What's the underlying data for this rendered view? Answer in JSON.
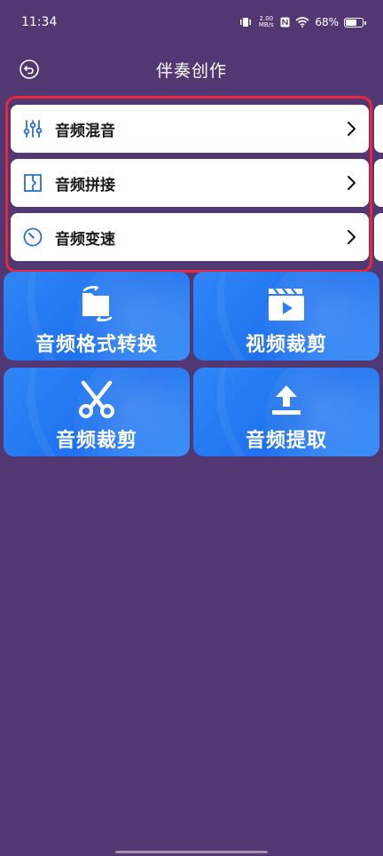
{
  "status_bar": {
    "time": "11:34",
    "net_speed_value": "2.00",
    "net_speed_unit": "MB/s",
    "battery": "68%"
  },
  "header": {
    "title": "伴奏创作"
  },
  "rows": [
    {
      "label": "音频混音",
      "icon": "sliders-icon"
    },
    {
      "label": "音频拼接",
      "icon": "splice-icon"
    },
    {
      "label": "音频变速",
      "icon": "speed-dial-icon"
    }
  ],
  "tiles": [
    {
      "label": "音频格式转换",
      "icon": "folder-convert-icon"
    },
    {
      "label": "视频裁剪",
      "icon": "video-clapper-icon"
    },
    {
      "label": "音频裁剪",
      "icon": "scissors-icon"
    },
    {
      "label": "音频提取",
      "icon": "upload-icon"
    }
  ],
  "colors": {
    "background": "#523872",
    "tile_blue": "#2a7ff5",
    "highlight": "#e8283e",
    "row_icon": "#2b6fd6"
  }
}
